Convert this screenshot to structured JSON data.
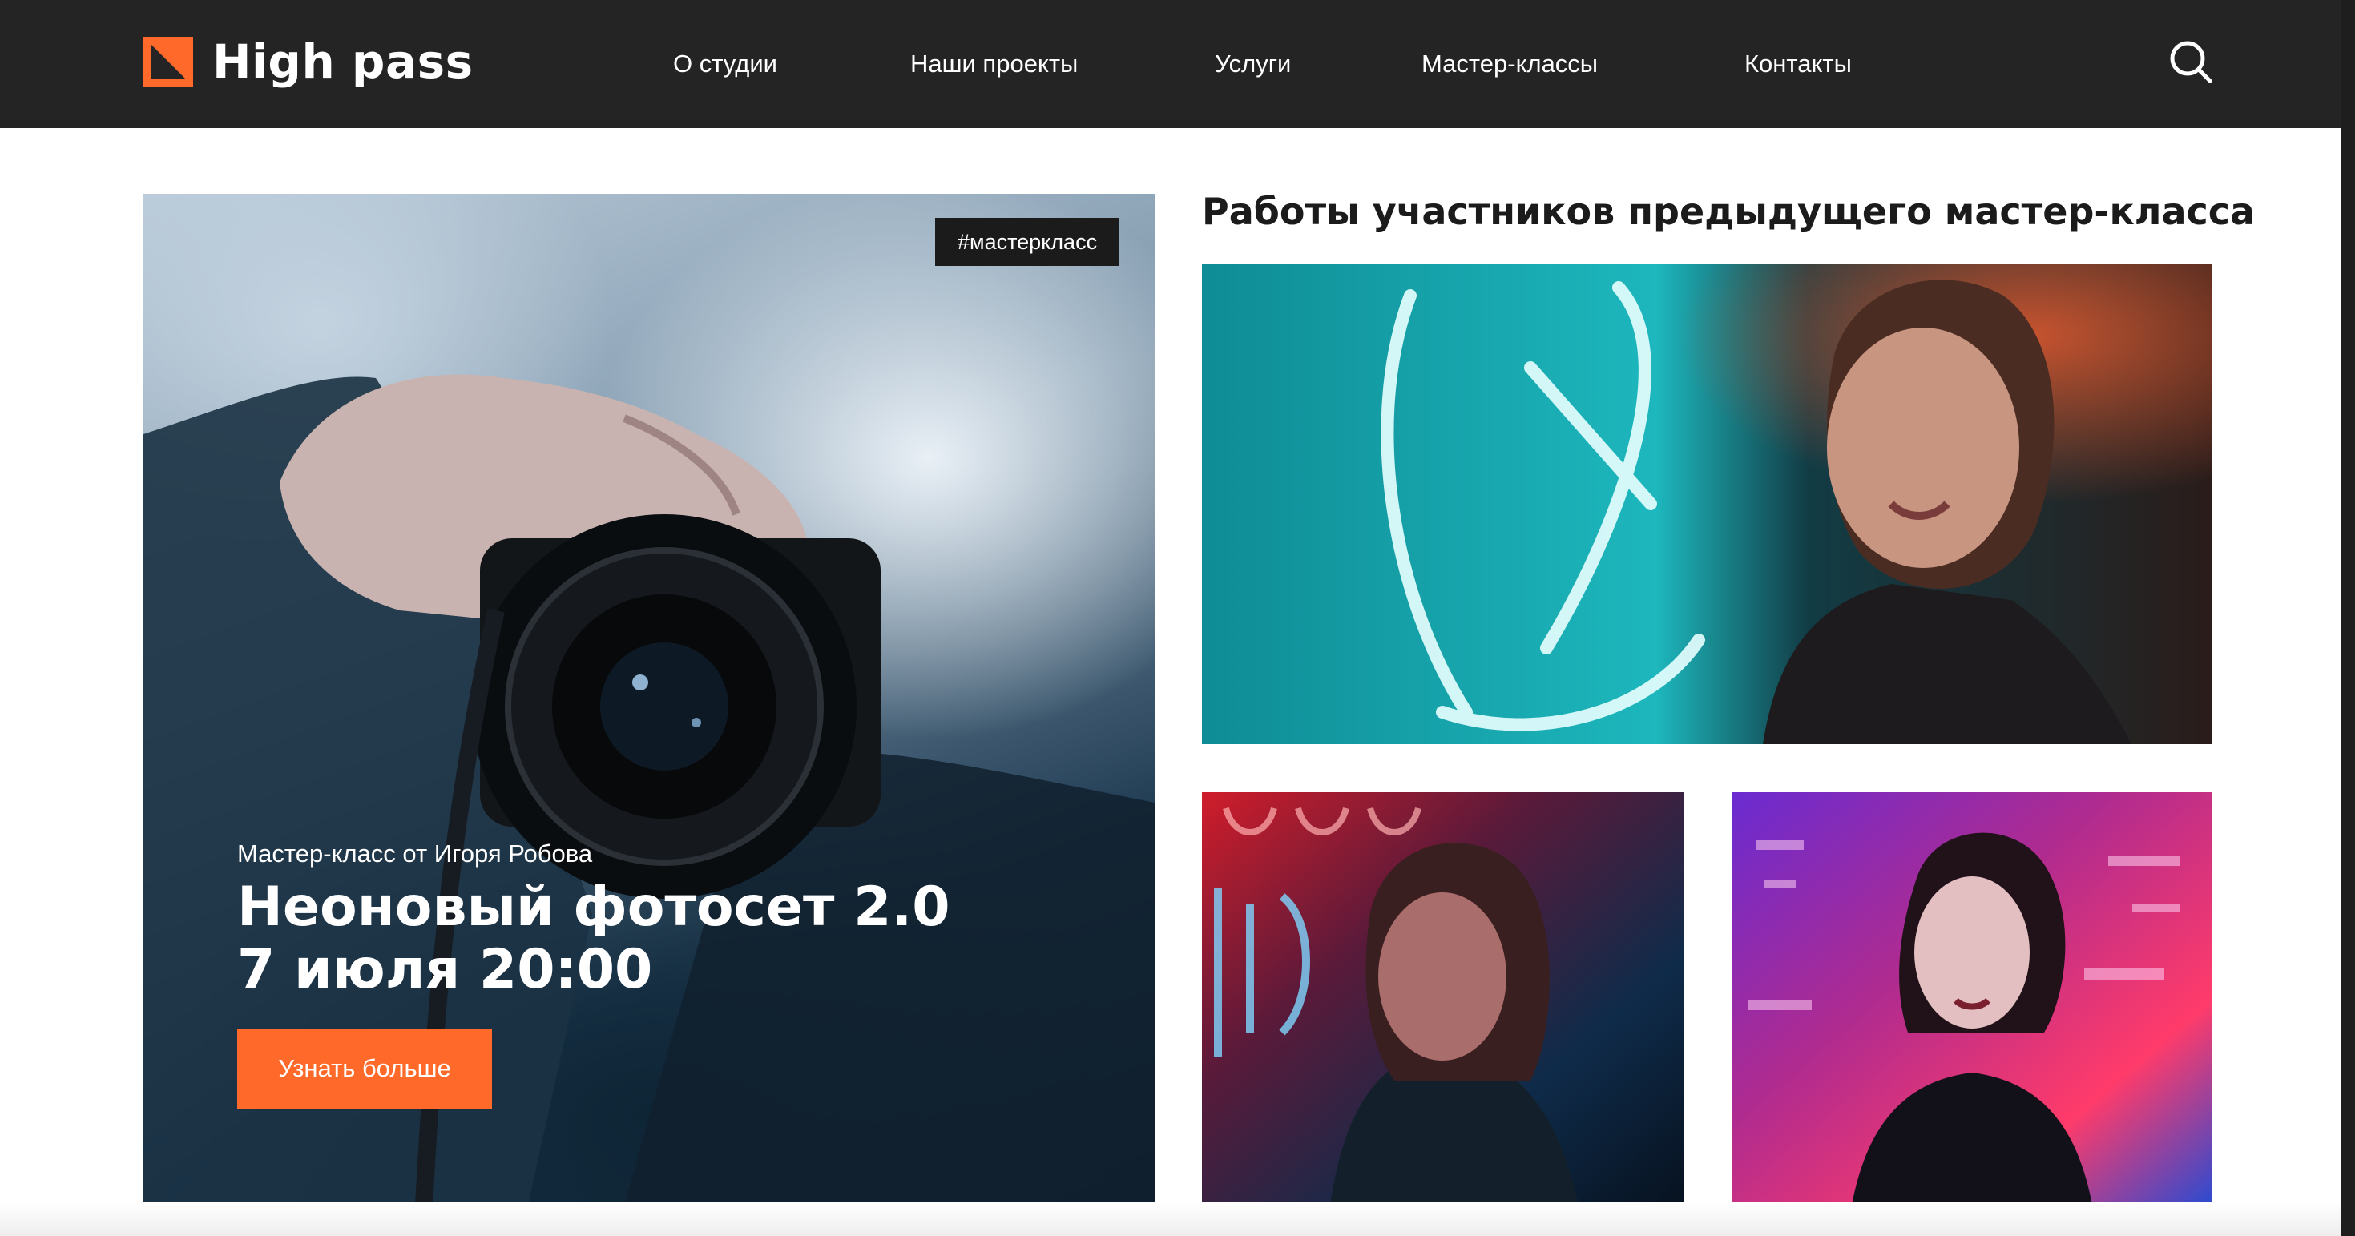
{
  "header": {
    "brand": "High pass",
    "nav": [
      "О студии",
      "Наши проекты",
      "Услуги",
      "Мастер-классы",
      "Контакты"
    ],
    "search_icon": "search-icon"
  },
  "hero": {
    "tag": "#мастеркласс",
    "subtitle": "Мастер-класс от Игоря Робова",
    "title_line1": "Неоновый фотосет 2.0",
    "title_line2": "7 июля 20:00",
    "button": "Узнать больше"
  },
  "gallery": {
    "title": "Работы участников предыдущего мастер-класса"
  },
  "colors": {
    "accent": "#ff6a2b",
    "header_bg": "#242424",
    "text_dark": "#1b1b1b"
  }
}
